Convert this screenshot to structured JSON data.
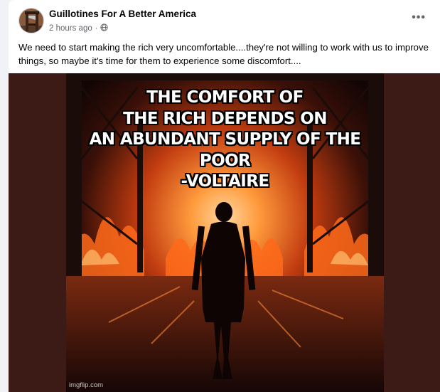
{
  "post": {
    "group_name": "Guillotines For A Better America",
    "time": "2 hours ago",
    "separator": "·",
    "privacy_icon": "globe-icon",
    "more_label": "•••",
    "text": "We need to start making the rich very uncomfortable....they're not willing to work with us to improve things, so maybe it's time for them to experience some discomfort...."
  },
  "meme": {
    "lines": [
      "THE COMFORT OF",
      "THE RICH DEPENDS ON",
      "AN ABUNDANT SUPPLY OF THE POOR",
      "-VOLTAIRE"
    ],
    "watermark": "imgflip.com"
  },
  "colors": {
    "page_bg": "#f0f2f5",
    "card_bg": "#ffffff",
    "media_bg": "#3c1b17",
    "fire": "#ff6a1a",
    "text_secondary": "#65676b"
  }
}
